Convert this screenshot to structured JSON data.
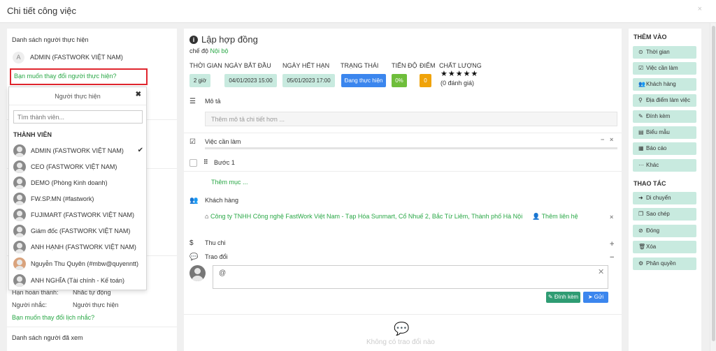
{
  "window": {
    "title": "Chi tiết công việc",
    "close_glyph": "×"
  },
  "left": {
    "assignees_title": "Danh sách người thực hiện",
    "avatar_letter": "A",
    "assignee": "ADMIN (FASTWORK VIỆT NAM)",
    "change_assignee_link": "Bạn muốn thay đổi người thực hiện?",
    "deadline_label": "Hạn hoàn thành:",
    "deadline_value": "Nhắc tự động",
    "reminder_label": "Người nhắc:",
    "reminder_value": "Người thực hiện",
    "change_reminder_link": "Bạn muốn thay đổi lịch nhắc?",
    "viewed_title": "Danh sách người đã xem"
  },
  "dropdown": {
    "title": "Người thực hiện",
    "close_glyph": "✖",
    "search_placeholder": "Tìm thành viên...",
    "group_label": "THÀNH VIÊN",
    "members": [
      {
        "name": "ADMIN (FASTWORK VIỆT NAM)",
        "checked": "✔"
      },
      {
        "name": "CEO (FASTWORK VIỆT NAM)",
        "checked": ""
      },
      {
        "name": "DEMO (Phòng Kinh doanh)",
        "checked": ""
      },
      {
        "name": "FW.SP.MN (#fastwork)",
        "checked": ""
      },
      {
        "name": "FUJIMART (FASTWORK VIỆT NAM)",
        "checked": ""
      },
      {
        "name": "Giám đốc (FASTWORK VIỆT NAM)",
        "checked": ""
      },
      {
        "name": "ANH HẠNH (FASTWORK VIỆT NAM)",
        "checked": ""
      },
      {
        "name": "Nguyễn Thu Quyên (#mbw@quyenntt)",
        "checked": ""
      },
      {
        "name": "ANH NGHĨA (Tài chính - Kế toán)",
        "checked": ""
      }
    ]
  },
  "task": {
    "title": "Lập hợp đồng",
    "mode_label": "chế độ",
    "mode_value": "Nội bộ",
    "headers": {
      "time": "THỜI GIAN",
      "start": "NGÀY BẮT ĐẦU",
      "end": "NGÀY HẾT HẠN",
      "status": "TRẠNG THÁI",
      "progress": "TIẾN ĐỘ",
      "score": "ĐIỂM",
      "quality": "CHẤT LƯỢNG"
    },
    "values": {
      "time": "2 giờ",
      "start": "04/01/2023 15:00",
      "end": "05/01/2023 17:00",
      "status": "Đang thực hiện",
      "progress": "0%",
      "score": "0"
    },
    "stars": "★★★★★",
    "rating_count": "(0 đánh giá)",
    "description_label": "Mô tả",
    "description_placeholder": "Thêm mô tả chi tiết hơn ...",
    "todo_label": "Việc cần làm",
    "todo_minus": "−",
    "todo_close": "×",
    "step_drag": "⠿",
    "step_label": "Bước 1",
    "add_item": "Thêm mục ...",
    "customer_label": "Khách hàng",
    "customer_link": "Công ty TNHH Công nghệ FastWork Việt Nam - Tạp Hóa Sunmart, Cổ Nhuế 2, Bắc Từ Liêm, Thành phố Hà Nội",
    "add_contact": "Thêm liên hệ",
    "customer_remove": "×",
    "finance_label": "Thu chi",
    "finance_add": "+",
    "discussion_label": "Trao đổi",
    "discussion_minus": "−",
    "comment_text": "@",
    "comment_clear": "✕",
    "attach_button": "Đính kèm",
    "send_button": "Gửi",
    "empty_text": "Không có trao đổi nào"
  },
  "icons": {
    "info": "i",
    "description": "☰",
    "todo": "☑",
    "customers": "👥",
    "home": "⌂",
    "contact": "👤",
    "dollar": "$",
    "comments": "💬",
    "paperclip": "✎",
    "send": "➤",
    "empty": "💬"
  },
  "right": {
    "add_title": "THÊM VÀO",
    "add_items": [
      {
        "icon": "⊙",
        "label": "Thời gian"
      },
      {
        "icon": "☑",
        "label": "Việc cần làm"
      },
      {
        "icon": "👥",
        "label": "Khách hàng"
      },
      {
        "icon": "⚲",
        "label": "Địa điểm làm việc"
      },
      {
        "icon": "✎",
        "label": "Đính kèm"
      },
      {
        "icon": "▤",
        "label": "Biểu mẫu"
      },
      {
        "icon": "▦",
        "label": "Báo cáo"
      },
      {
        "icon": "···",
        "label": "Khác"
      }
    ],
    "action_title": "THAO TÁC",
    "action_items": [
      {
        "icon": "➜",
        "label": "Di chuyển"
      },
      {
        "icon": "❐",
        "label": "Sao chép"
      },
      {
        "icon": "⊘",
        "label": "Đóng"
      },
      {
        "icon": "🗑",
        "label": "Xóa"
      },
      {
        "icon": "⚙",
        "label": "Phân quyền"
      }
    ]
  },
  "colors": {
    "accent": "#28a745",
    "status": "#3b86ee",
    "progress": "#6fbe3b",
    "score": "#f0a30a",
    "pill": "#c8eadf",
    "highlight": "#e0262e"
  }
}
